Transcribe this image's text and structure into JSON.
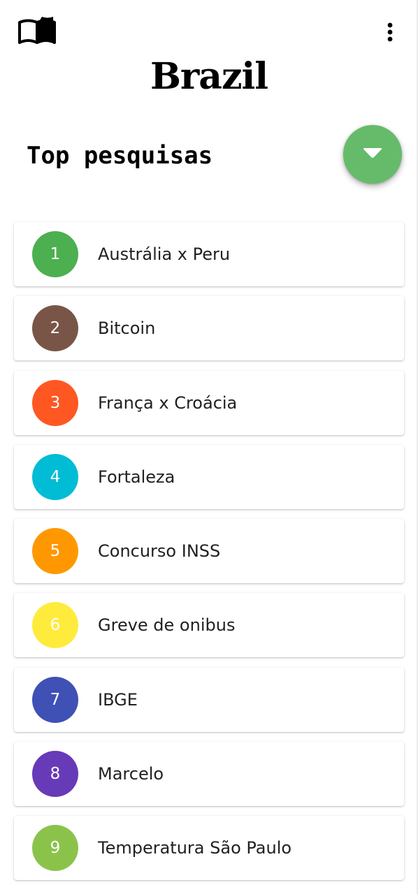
{
  "header": {
    "app_icon": "open-book-icon",
    "menu_icon": "more-vert-icon",
    "title": "Brazil"
  },
  "section": {
    "title": "Top pesquisas",
    "fab_icon": "caret-down-icon",
    "fab_color": "#66bb6a"
  },
  "trends": [
    {
      "rank": "1",
      "term": "Austrália x Peru",
      "color": "#4caf50"
    },
    {
      "rank": "2",
      "term": "Bitcoin",
      "color": "#795548"
    },
    {
      "rank": "3",
      "term": "França x Croácia",
      "color": "#ff5722"
    },
    {
      "rank": "4",
      "term": "Fortaleza",
      "color": "#00bcd4"
    },
    {
      "rank": "5",
      "term": "Concurso INSS",
      "color": "#ff9800"
    },
    {
      "rank": "6",
      "term": "Greve de onibus",
      "color": "#ffeb3b"
    },
    {
      "rank": "7",
      "term": "IBGE",
      "color": "#3f51b5"
    },
    {
      "rank": "8",
      "term": "Marcelo",
      "color": "#673ab7"
    },
    {
      "rank": "9",
      "term": "Temperatura São Paulo",
      "color": "#8bc34a"
    }
  ]
}
